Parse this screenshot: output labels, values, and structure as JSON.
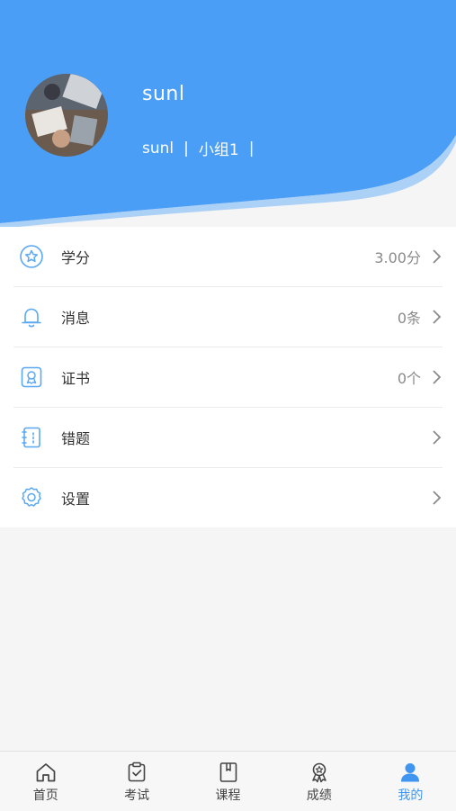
{
  "profile": {
    "username": "sunl",
    "account": "sunl",
    "separator": "|",
    "group": "小组1"
  },
  "colors": {
    "header_blue": "#4a9ef5",
    "active_tab": "#3f95f0",
    "icon_blue": "#5aa8f2"
  },
  "menu": [
    {
      "icon": "star-icon",
      "label": "学分",
      "value": "3.00分"
    },
    {
      "icon": "bell-icon",
      "label": "消息",
      "value": "0条"
    },
    {
      "icon": "certificate-icon",
      "label": "证书",
      "value": "0个"
    },
    {
      "icon": "notebook-icon",
      "label": "错题",
      "value": ""
    },
    {
      "icon": "gear-icon",
      "label": "设置",
      "value": ""
    }
  ],
  "tabs": [
    {
      "icon": "home-icon",
      "label": "首页"
    },
    {
      "icon": "clipboard-check-icon",
      "label": "考试"
    },
    {
      "icon": "book-icon",
      "label": "课程"
    },
    {
      "icon": "medal-icon",
      "label": "成绩"
    },
    {
      "icon": "user-icon",
      "label": "我的",
      "active": true
    }
  ]
}
